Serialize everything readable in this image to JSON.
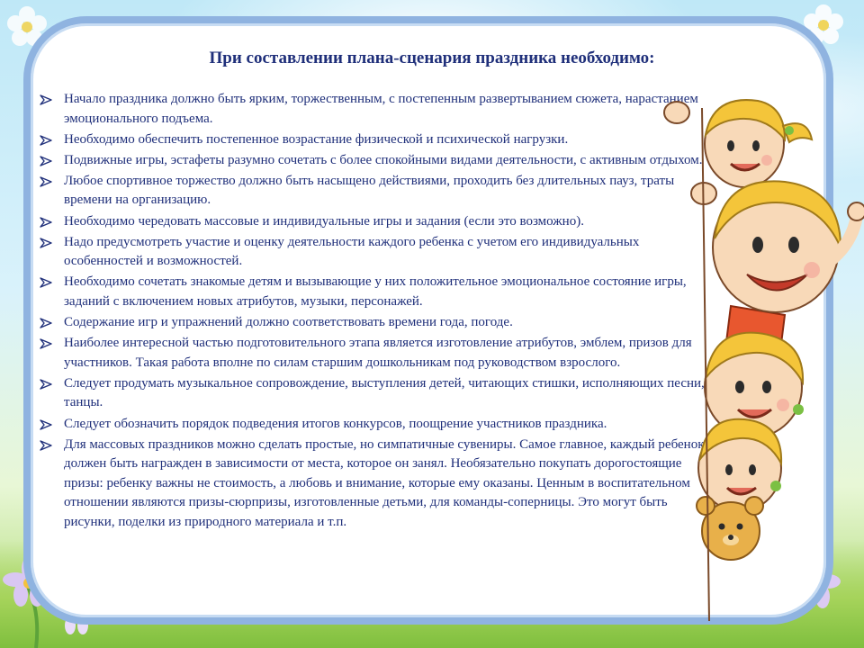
{
  "title": "При составлении плана-сценария праздника необходимо:",
  "bullets": [
    "Начало праздника должно быть ярким, торжественным, с постепенным развертыванием сюжета, нарастанием эмоционального подъема.",
    "Необходимо обеспечить постепенное возрастание физической и психической нагрузки.",
    "Подвижные игры, эстафеты разумно сочетать с более спокойными видами деятельности, с активным отдыхом.",
    "Любое спортивное торжество должно быть насыщено действиями, проходить без длительных пауз, траты времени на организацию.",
    "Необходимо чередовать массовые и индивидуальные игры и задания (если это возможно).",
    "Надо предусмотреть участие и оценку деятельности каждого ребенка с учетом его индивидуальных особенностей и возможностей.",
    "Необходимо сочетать знакомые детям и вызывающие у них положительное эмоциональное состояние игры, заданий с включением новых атрибутов, музыки, персонажей.",
    "Содержание игр и упражнений должно соответствовать времени года, погоде.",
    "Наиболее интересной частью подготовительного этапа является изготовление атрибутов, эмблем, призов для участников. Такая работа вполне по силам старшим дошкольникам под руководством взрослого.",
    "Следует продумать музыкальное сопровождение, выступления детей, читающих стишки, исполняющих песни, танцы.",
    "Следует обозначить порядок подведения итогов конкурсов, поощрение участников праздника.",
    "Для массовых праздников можно сделать простые, но симпатичные сувениры. Самое главное, каждый ребенок должен быть награжден в зависимости от места, которое он занял. Необязательно покупать дорогостоящие призы: ребенку важны не стоимость, а любовь и внимание, которые ему оказаны. Ценным в воспитательном отношении являются призы-сюрпризы, изготовленные детьми, для команды-соперницы. Это могут быть рисунки, поделки из природного материала и т.п."
  ],
  "colors": {
    "text": "#1f2f7a",
    "panel_border": "#8fb3e0",
    "bullet": "#1f2f7a"
  },
  "icons": {
    "bullet": "arrow-bullet-icon",
    "illustration": "children-peeking-illustration"
  }
}
